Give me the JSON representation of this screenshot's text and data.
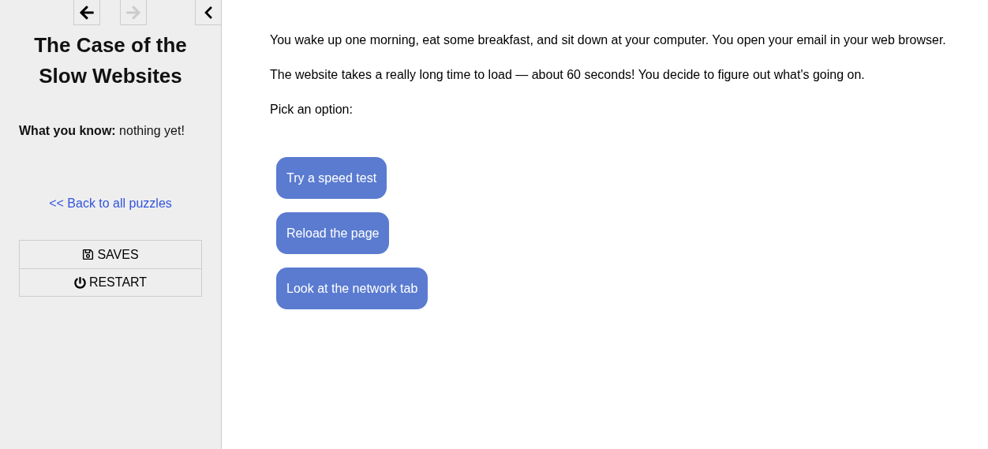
{
  "sidebar": {
    "nav": {
      "back_disabled": false,
      "forward_disabled": true
    },
    "title": "The Case of the Slow Websites",
    "knowledge": {
      "label": "What you know:",
      "value": "nothing yet!"
    },
    "back_link": "<< Back to all puzzles",
    "menu": [
      {
        "kind": "save",
        "label": "SAVES"
      },
      {
        "kind": "restart",
        "label": "RESTART"
      }
    ]
  },
  "story": {
    "paragraphs": [
      "You wake up one morning, eat some breakfast, and sit down at your computer. You open your email in your web browser.",
      "The website takes a really long time to load — about 60 seconds! You decide to figure out what's going on.",
      "Pick an option:"
    ],
    "options": [
      "Try a speed test",
      "Reload the page",
      "Look at the network tab"
    ]
  }
}
